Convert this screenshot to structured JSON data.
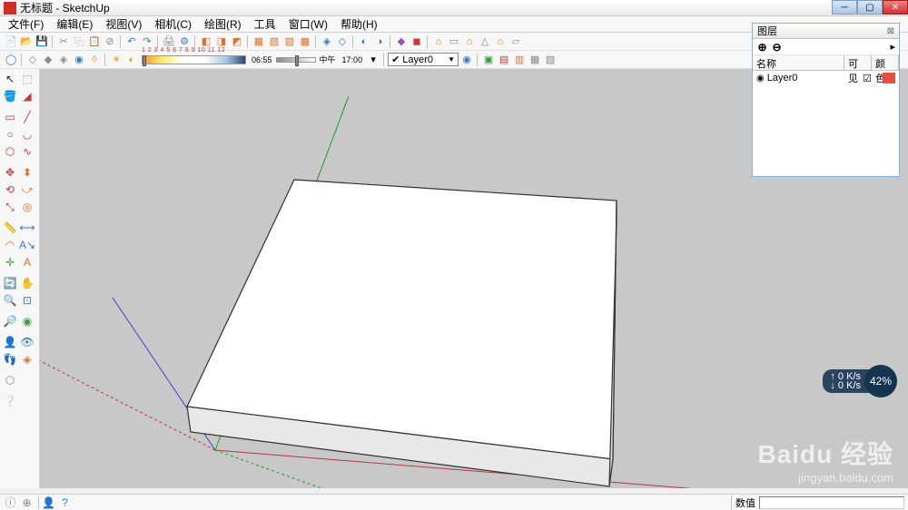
{
  "title": "无标题 - SketchUp",
  "menu": [
    "文件(F)",
    "编辑(E)",
    "视图(V)",
    "相机(C)",
    "绘图(R)",
    "工具",
    "窗口(W)",
    "帮助(H)"
  ],
  "time": {
    "ticks": "1 2 3 4 5 6 7 8 9 10 11 12",
    "start": "06:55",
    "mid": "中午",
    "end": "17:00"
  },
  "layer_dropdown": "Layer0",
  "layers_panel": {
    "title": "图层",
    "h_name": "名称",
    "h_vis": "可见",
    "h_color": "颜色",
    "rows": [
      {
        "name": "Layer0"
      }
    ]
  },
  "status": {
    "value_label": "数值"
  },
  "net": {
    "up": "↑ 0 K/s",
    "down": "↓ 0 K/s",
    "pct": "42%"
  },
  "watermark": {
    "big": "Baidu 经验",
    "small": "jingyan.baidu.com"
  }
}
